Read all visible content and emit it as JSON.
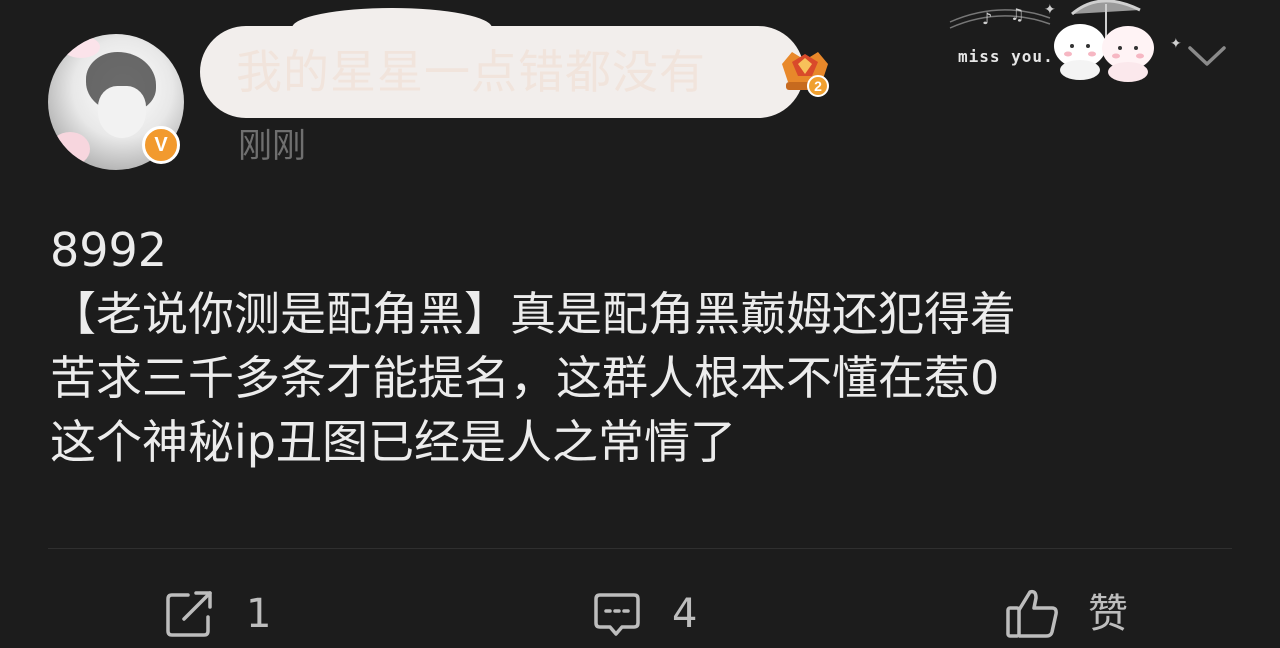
{
  "post": {
    "author": {
      "name": "我的星星一点错都没有",
      "vip_badge": "V",
      "level": "2"
    },
    "timestamp": "刚刚",
    "sticker_text": "miss you.",
    "content_lines": [
      "8992",
      "【老说你测是配角黑】真是配角黑巅姆还犯得着",
      "苦求三千多条才能提名，这群人根本不懂在惹0",
      "这个神秘ip丑图已经是人之常情了"
    ]
  },
  "actions": {
    "repost": {
      "count": "1"
    },
    "comment": {
      "count": "4"
    },
    "like": {
      "label": "赞"
    }
  },
  "colors": {
    "background": "#1c1c1c",
    "text": "#ececec",
    "muted": "#6f6f6f",
    "vip": "#f29a2e"
  }
}
